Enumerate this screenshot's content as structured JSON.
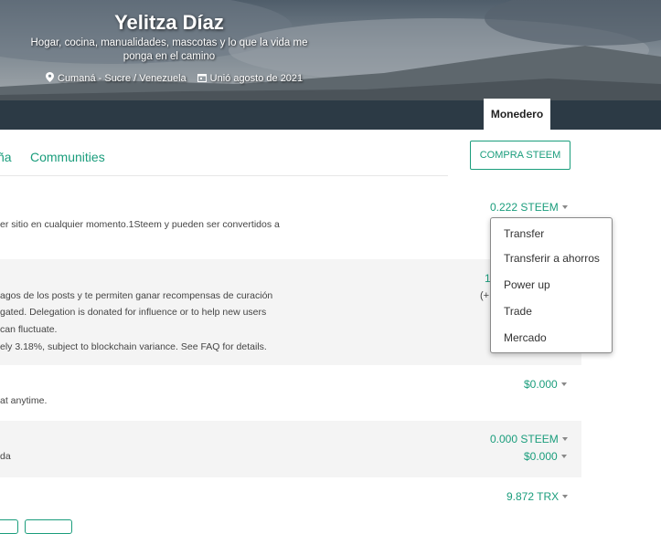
{
  "profile": {
    "name": "Yelitza Díaz",
    "bio": "Hogar, cocina, manualidades, mascotas y lo que la vida me ponga en el camino",
    "location": "Cumaná - Sucre / Venezuela",
    "joined": "Unió agosto de 2021"
  },
  "nav": {
    "active_tab": "Monedero"
  },
  "subtabs": {
    "partial": "ña",
    "communities": "Communities"
  },
  "buy_button": "COMPRA STEEM",
  "wallet": {
    "steem": {
      "value": "0.222 STEEM",
      "description": "er sitio en cualquier momento.1Steem y pueden ser convertidos a"
    },
    "steem_power": {
      "value_partial": "1",
      "value_partial_2": "(+",
      "lines": [
        "agos de los posts y te permiten ganar recompensas de curación",
        "gated. Delegation is donated for influence or to help new users",
        "can fluctuate.",
        "ely 3.18%, subject to blockchain variance. See FAQ for details."
      ]
    },
    "steem_dollars": {
      "value": "$0.000",
      "description": "at anytime."
    },
    "savings": {
      "value_steem": "0.000 STEEM",
      "value_sbd": "$0.000",
      "description": "da"
    },
    "trx": {
      "value": "9.872 TRX"
    }
  },
  "dropdown": {
    "items": [
      "Transfer",
      "Transferir a ahorros",
      "Power up",
      "Trade",
      "Mercado"
    ]
  },
  "colors": {
    "accent": "#1a9d7c",
    "navbar": "#2c3a45"
  },
  "icons": {
    "location": "map-pin-icon",
    "calendar": "calendar-icon",
    "caret": "caret-down-icon"
  }
}
